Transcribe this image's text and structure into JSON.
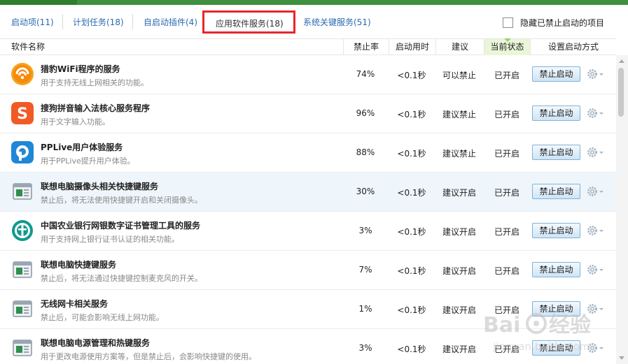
{
  "tabs": [
    {
      "label": "启动项(11)"
    },
    {
      "label": "计划任务(18)"
    },
    {
      "label": "自启动插件(4)"
    },
    {
      "label": "应用软件服务(18)"
    },
    {
      "label": "系统关键服务(51)"
    }
  ],
  "hide_disabled_label": "隐藏已禁止启动的项目",
  "columns": {
    "name": "软件名称",
    "rate": "禁止率",
    "time": "启动用时",
    "advice": "建议",
    "status": "当前状态",
    "setting": "设置启动方式"
  },
  "rows": [
    {
      "name": "猎豹WiFi程序的服务",
      "desc": "用于支持无线上网相关的功能。",
      "rate": "74%",
      "time": "<0.1秒",
      "advice": "可以禁止",
      "status": "已开启",
      "button": "禁止启动",
      "icon": "wifi-icon"
    },
    {
      "name": "搜狗拼音输入法核心服务程序",
      "desc": "用于文字输入功能。",
      "rate": "96%",
      "time": "<0.1秒",
      "advice": "建议禁止",
      "status": "已开启",
      "button": "禁止启动",
      "icon": "sogou-icon"
    },
    {
      "name": "PPLive用户体验服务",
      "desc": "用于PPLive提升用户体验。",
      "rate": "88%",
      "time": "<0.1秒",
      "advice": "建议禁止",
      "status": "已开启",
      "button": "禁止启动",
      "icon": "pplive-icon"
    },
    {
      "name": "联想电脑摄像头相关快捷键服务",
      "desc": "禁止后，将无法使用快捷键开启和关闭摄像头。",
      "rate": "30%",
      "time": "<0.1秒",
      "advice": "建议开启",
      "status": "已开启",
      "button": "禁止启动",
      "icon": "program-window-icon"
    },
    {
      "name": "中国农业银行网银数字证书管理工具的服务",
      "desc": "用于支持网上银行证书认证的相关功能。",
      "rate": "3%",
      "time": "<0.1秒",
      "advice": "建议开启",
      "status": "已开启",
      "button": "禁止启动",
      "icon": "abc-bank-icon"
    },
    {
      "name": "联想电脑快捷键服务",
      "desc": "禁止后，将无法通过快捷键控制麦克风的开关。",
      "rate": "7%",
      "time": "<0.1秒",
      "advice": "建议开启",
      "status": "已开启",
      "button": "禁止启动",
      "icon": "program-window-icon"
    },
    {
      "name": "无线网卡相关服务",
      "desc": "禁止后，可能会影响无线上网功能。",
      "rate": "1%",
      "time": "<0.1秒",
      "advice": "建议开启",
      "status": "已开启",
      "button": "禁止启动",
      "icon": "program-window-icon"
    },
    {
      "name": "联想电脑电源管理和热键服务",
      "desc": "用于更改电源使用方案等，但是禁止后，会影响快捷键的使用。",
      "rate": "3%",
      "time": "<0.1秒",
      "advice": "建议开启",
      "status": "已开启",
      "button": "禁止启动",
      "icon": "program-window-icon"
    }
  ],
  "colors": {
    "accent_red": "#e8262a",
    "link_blue": "#2a6bb0",
    "top_green": "#3e8f3e",
    "status_col_bg": "#eaf6d8",
    "row_highlight": "#eef6fb"
  },
  "watermark": {
    "text": "Bai 经验",
    "url": "jingyan.baidu.com"
  }
}
